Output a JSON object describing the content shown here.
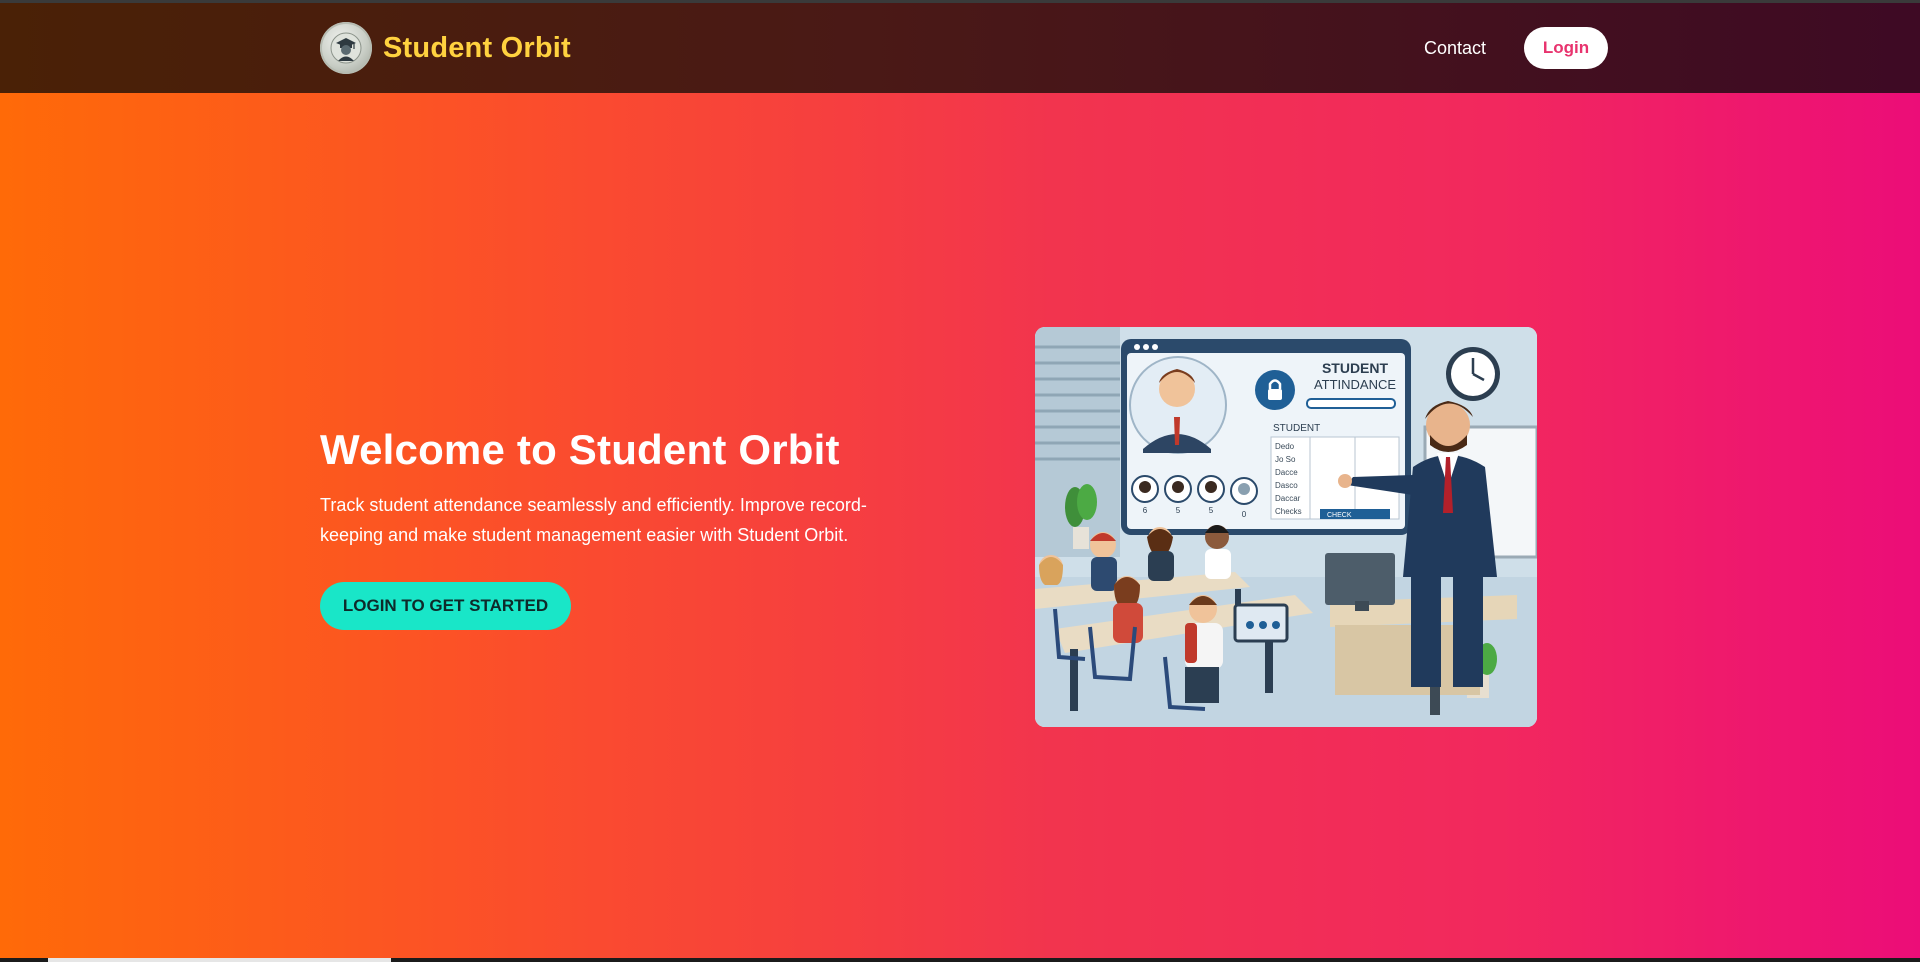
{
  "header": {
    "brand_name": "Student Orbit",
    "nav": {
      "contact_label": "Contact",
      "login_label": "Login"
    }
  },
  "hero": {
    "title": "Welcome to Student Orbit",
    "description": "Track student attendance seamlessly and efficiently. Improve record-keeping and make student management easier with Student Orbit.",
    "cta_label": "LOGIN TO GET STARTED"
  },
  "illustration": {
    "panel_title_line1": "STUDENT",
    "panel_title_line2": "ATTINDANCE",
    "table_header": "STUDENT",
    "rows": [
      "Dedo",
      "Jo So",
      "Dacce",
      "Dasco",
      "Daccar",
      "Checks"
    ],
    "avatar_numbers": [
      "6",
      "5",
      "5",
      "0"
    ],
    "button_label": "CHECK"
  },
  "colors": {
    "accent_cta": "#19e6c8",
    "brand_text": "#ffd23f",
    "login_text": "#e8336e",
    "gradient_start": "#ff6a08",
    "gradient_end": "#ec0d78"
  },
  "icons": [
    "graduate-logo-icon"
  ]
}
